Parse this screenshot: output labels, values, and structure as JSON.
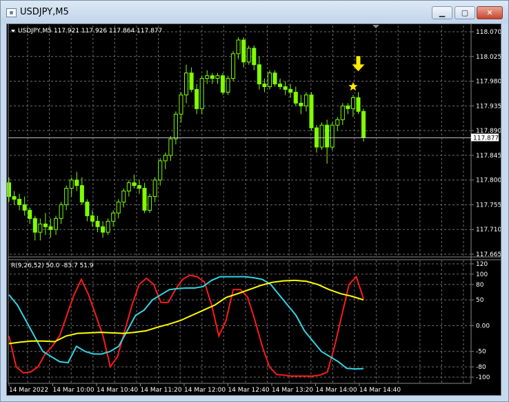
{
  "window": {
    "title": "USDJPY,M5",
    "icon_name": "chart-window-icon",
    "buttons": {
      "minimize": "minimize-icon",
      "maximize": "maximize-icon",
      "close": "close-icon"
    }
  },
  "colors": {
    "background": "#000000",
    "grid": "#6e6e6e",
    "candle": "#7fff00",
    "price_line": "#c0c0c0",
    "red_line": "#ff1a1a",
    "cyan_line": "#33d6e6",
    "yellow_line": "#ffff00",
    "signal": "#ffea00",
    "text": "#ffffff"
  },
  "price_chart": {
    "header": "USDJPY,M5  117.921 117.926 117.864 117.877",
    "current_price_label": "117.877",
    "current_price": 117.877,
    "y_ticks": [
      "118.070",
      "118.025",
      "117.980",
      "117.935",
      "117.890",
      "117.845",
      "117.800",
      "117.755",
      "117.710",
      "117.665"
    ],
    "ylim": [
      117.665,
      118.07
    ],
    "candles": [
      [
        117.795,
        117.805,
        117.76,
        117.77
      ],
      [
        117.77,
        117.78,
        117.755,
        117.765
      ],
      [
        117.765,
        117.775,
        117.745,
        117.755
      ],
      [
        117.755,
        117.77,
        117.735,
        117.745
      ],
      [
        117.745,
        117.75,
        117.72,
        117.73
      ],
      [
        117.73,
        117.735,
        117.69,
        117.705
      ],
      [
        117.705,
        117.73,
        117.69,
        117.72
      ],
      [
        117.72,
        117.74,
        117.7,
        117.715
      ],
      [
        117.715,
        117.73,
        117.695,
        117.71
      ],
      [
        117.71,
        117.735,
        117.7,
        117.73
      ],
      [
        117.73,
        117.76,
        117.72,
        117.755
      ],
      [
        117.755,
        117.79,
        117.745,
        117.785
      ],
      [
        117.785,
        117.805,
        117.77,
        117.8
      ],
      [
        117.8,
        117.815,
        117.78,
        117.79
      ],
      [
        117.79,
        117.805,
        117.755,
        117.76
      ],
      [
        117.76,
        117.765,
        117.725,
        117.735
      ],
      [
        117.735,
        117.745,
        117.715,
        117.725
      ],
      [
        117.725,
        117.735,
        117.705,
        117.715
      ],
      [
        117.715,
        117.725,
        117.695,
        117.705
      ],
      [
        117.705,
        117.73,
        117.7,
        117.725
      ],
      [
        117.725,
        117.745,
        117.715,
        117.74
      ],
      [
        117.74,
        117.765,
        117.73,
        117.76
      ],
      [
        117.76,
        117.785,
        117.75,
        117.78
      ],
      [
        117.78,
        117.8,
        117.77,
        117.795
      ],
      [
        117.795,
        117.81,
        117.785,
        117.79
      ],
      [
        117.79,
        117.8,
        117.775,
        117.785
      ],
      [
        117.785,
        117.795,
        117.74,
        117.745
      ],
      [
        117.745,
        117.775,
        117.74,
        117.77
      ],
      [
        117.77,
        117.805,
        117.76,
        117.8
      ],
      [
        117.8,
        117.84,
        117.79,
        117.835
      ],
      [
        117.835,
        117.85,
        117.82,
        117.845
      ],
      [
        117.845,
        117.88,
        117.835,
        117.875
      ],
      [
        117.875,
        117.925,
        117.865,
        117.92
      ],
      [
        117.92,
        117.96,
        117.905,
        117.955
      ],
      [
        117.955,
        118.01,
        117.94,
        117.995
      ],
      [
        117.995,
        118.005,
        117.96,
        117.965
      ],
      [
        117.965,
        117.975,
        117.92,
        117.93
      ],
      [
        117.93,
        117.99,
        117.92,
        117.985
      ],
      [
        117.985,
        118.0,
        117.975,
        117.99
      ],
      [
        117.99,
        117.995,
        117.975,
        117.985
      ],
      [
        117.985,
        117.995,
        117.975,
        117.99
      ],
      [
        117.99,
        117.995,
        117.955,
        117.96
      ],
      [
        117.96,
        117.99,
        117.955,
        117.985
      ],
      [
        117.985,
        118.035,
        117.98,
        118.03
      ],
      [
        118.03,
        118.06,
        118.02,
        118.055
      ],
      [
        118.055,
        118.06,
        118.005,
        118.015
      ],
      [
        118.015,
        118.045,
        118.01,
        118.04
      ],
      [
        118.04,
        118.045,
        118.0,
        118.01
      ],
      [
        118.01,
        118.025,
        117.965,
        117.975
      ],
      [
        117.975,
        117.985,
        117.96,
        117.97
      ],
      [
        117.97,
        118.0,
        117.965,
        117.995
      ],
      [
        117.995,
        118.0,
        117.97,
        117.975
      ],
      [
        117.975,
        117.985,
        117.965,
        117.97
      ],
      [
        117.97,
        117.98,
        117.955,
        117.965
      ],
      [
        117.965,
        117.975,
        117.95,
        117.96
      ],
      [
        117.96,
        117.97,
        117.935,
        117.94
      ],
      [
        117.94,
        117.955,
        117.92,
        117.935
      ],
      [
        117.935,
        117.96,
        117.925,
        117.955
      ],
      [
        117.955,
        117.96,
        117.89,
        117.895
      ],
      [
        117.895,
        117.9,
        117.85,
        117.86
      ],
      [
        117.86,
        117.905,
        117.855,
        117.9
      ],
      [
        117.9,
        117.91,
        117.83,
        117.86
      ],
      [
        117.86,
        117.905,
        117.855,
        117.9
      ],
      [
        117.9,
        117.915,
        117.89,
        117.91
      ],
      [
        117.91,
        117.94,
        117.9,
        117.935
      ],
      [
        117.935,
        117.94,
        117.92,
        117.93
      ],
      [
        117.93,
        117.955,
        117.915,
        117.95
      ],
      [
        117.95,
        117.96,
        117.92,
        117.925
      ],
      [
        117.925,
        117.93,
        117.87,
        117.877
      ]
    ],
    "signals": [
      {
        "type": "star",
        "candle": 66,
        "price": 117.97
      },
      {
        "type": "down-arrow",
        "candle": 67,
        "price": 117.998
      }
    ]
  },
  "indicator": {
    "header": "R(9,26,52) 50.0 -83.7 51.9",
    "y_ticks": [
      "120",
      "100",
      "80",
      "50",
      "0.00",
      "-50",
      "-80",
      "-100"
    ],
    "ylim": [
      -100,
      120
    ],
    "series": [
      {
        "key": "red",
        "values": [
          -20,
          -80,
          -92,
          -90,
          -80,
          -55,
          -40,
          -20,
          20,
          60,
          90,
          60,
          20,
          -20,
          -80,
          -60,
          -10,
          40,
          80,
          92,
          80,
          45,
          45,
          70,
          90,
          98,
          95,
          85,
          40,
          -20,
          10,
          70,
          70,
          55,
          10,
          -40,
          -80,
          -95,
          -96,
          -98,
          -98,
          -98,
          -98,
          -96,
          -90,
          -40,
          20,
          80,
          95,
          51.9
        ]
      },
      {
        "key": "cyan",
        "values": [
          60,
          40,
          10,
          -20,
          -50,
          -60,
          -70,
          -72,
          -40,
          -50,
          -55,
          -55,
          -50,
          -40,
          -10,
          20,
          30,
          50,
          60,
          70,
          72,
          73,
          73,
          76,
          88,
          95,
          95,
          95,
          95,
          93,
          90,
          80,
          60,
          40,
          20,
          -10,
          -30,
          -50,
          -60,
          -70,
          -83,
          -84,
          -83.7
        ]
      },
      {
        "key": "yellow",
        "values": [
          -35,
          -32,
          -30,
          -30,
          -31,
          -20,
          -15,
          -14,
          -13,
          -14,
          -15,
          -13,
          -10,
          -3,
          3,
          10,
          20,
          30,
          40,
          55,
          62,
          70,
          78,
          84,
          87,
          88,
          86,
          80,
          70,
          62,
          57,
          50
        ]
      }
    ]
  },
  "x_axis": {
    "ticks": [
      "14 Mar 2022",
      "14 Mar 10:00",
      "14 Mar 10:40",
      "14 Mar 11:20",
      "14 Mar 12:00",
      "14 Mar 12:40",
      "14 Mar 13:20",
      "14 Mar 14:00",
      "14 Mar 14:40"
    ]
  }
}
